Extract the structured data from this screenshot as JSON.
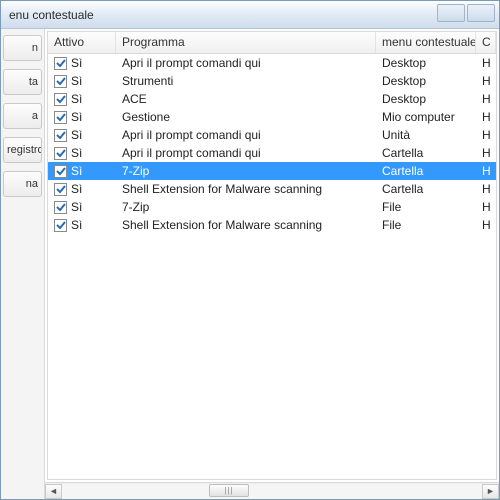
{
  "window": {
    "title": "enu contestuale"
  },
  "sidebar": {
    "buttons": [
      {
        "label": "n"
      },
      {
        "label": "ta"
      },
      {
        "label": "a"
      },
      {
        "label": "registro"
      },
      {
        "label": "na"
      }
    ]
  },
  "table": {
    "headers": {
      "attivo": "Attivo",
      "programma": "Programma",
      "menu": "menu contestuale",
      "last": "C"
    },
    "attivo_value": "Sì",
    "rows": [
      {
        "programma": "Apri il prompt comandi qui",
        "menu": "Desktop",
        "last": "H",
        "selected": false
      },
      {
        "programma": "Strumenti",
        "menu": "Desktop",
        "last": "H",
        "selected": false
      },
      {
        "programma": "ACE",
        "menu": "Desktop",
        "last": "H",
        "selected": false
      },
      {
        "programma": "Gestione",
        "menu": "Mio computer",
        "last": "H",
        "selected": false
      },
      {
        "programma": "Apri il prompt comandi qui",
        "menu": "Unità",
        "last": "H",
        "selected": false
      },
      {
        "programma": "Apri il prompt comandi qui",
        "menu": "Cartella",
        "last": "H",
        "selected": false
      },
      {
        "programma": "7-Zip",
        "menu": "Cartella",
        "last": "H",
        "selected": true
      },
      {
        "programma": "Shell Extension for Malware scanning",
        "menu": "Cartella",
        "last": "H",
        "selected": false
      },
      {
        "programma": "7-Zip",
        "menu": "File",
        "last": "H",
        "selected": false
      },
      {
        "programma": "Shell Extension for Malware scanning",
        "menu": "File",
        "last": "H",
        "selected": false
      }
    ]
  },
  "colors": {
    "selection": "#3399ff"
  }
}
